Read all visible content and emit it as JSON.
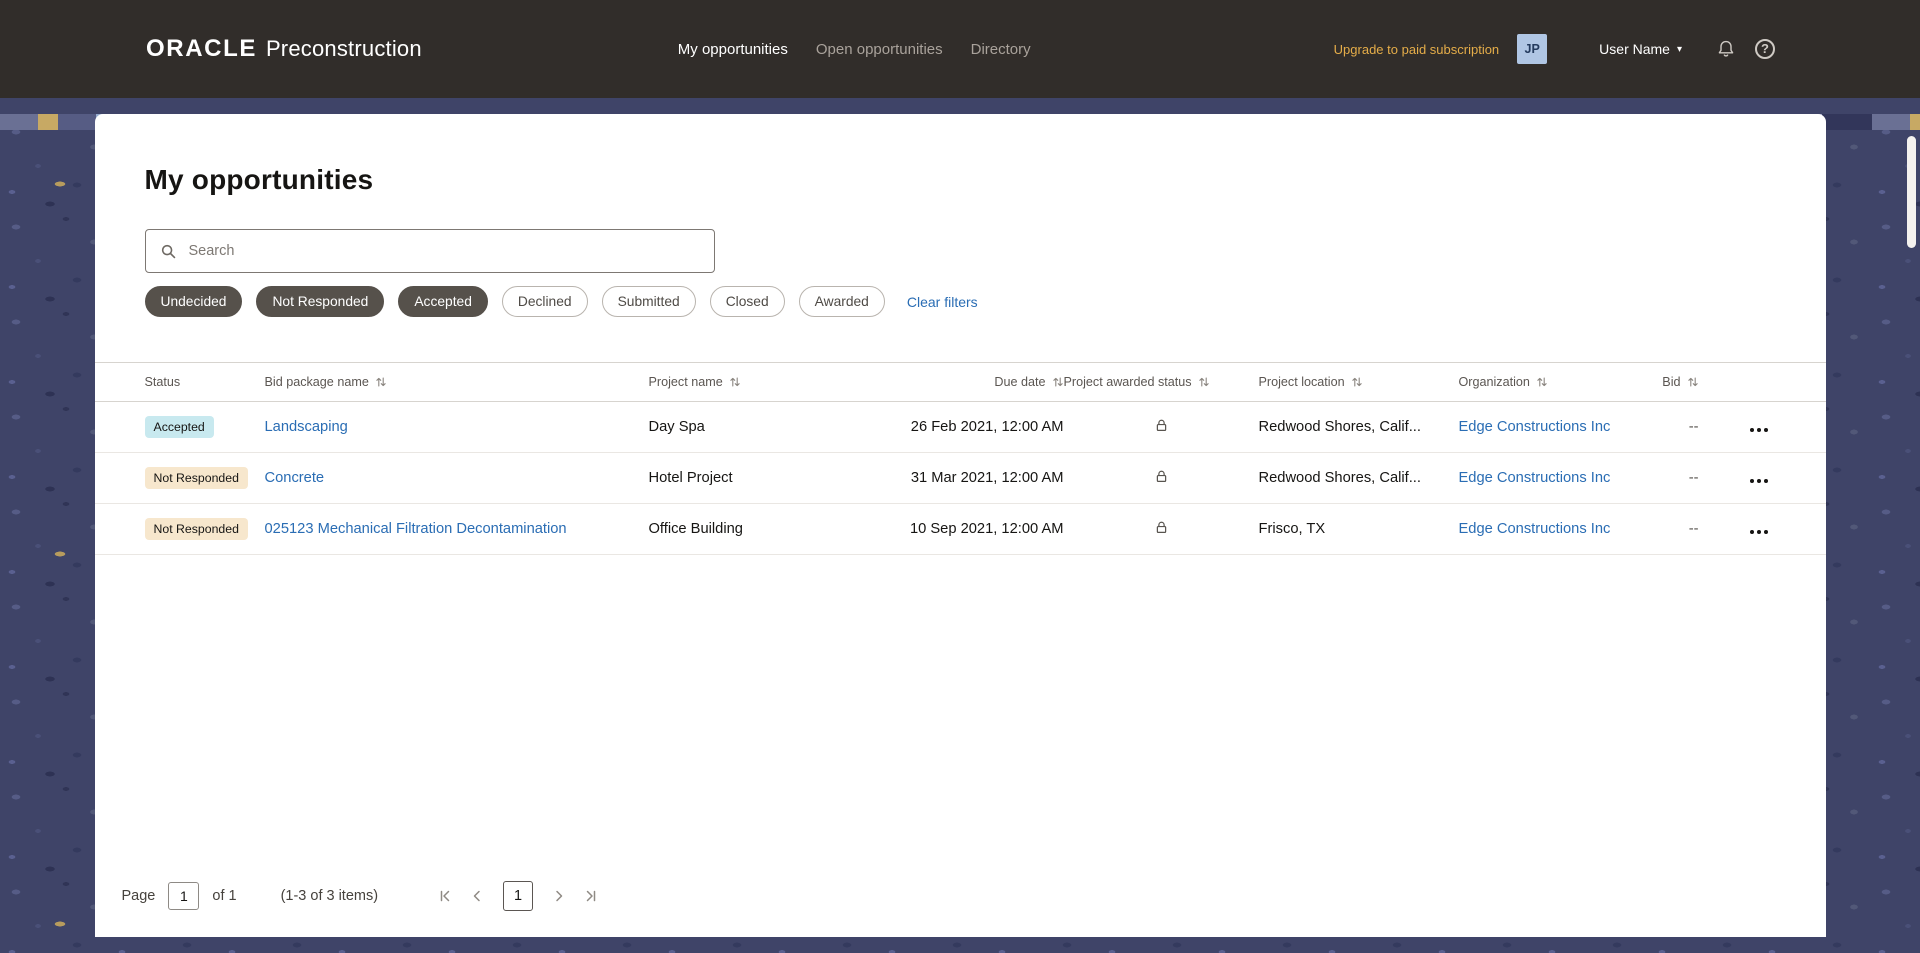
{
  "navbar": {
    "brand_oracle": "ORACLE",
    "brand_product": "Preconstruction",
    "nav_items": [
      {
        "label": "My opportunities",
        "active": true
      },
      {
        "label": "Open opportunities",
        "active": false
      },
      {
        "label": "Directory",
        "active": false
      }
    ],
    "upgrade_link": "Upgrade to paid subscription",
    "avatar_initials": "JP",
    "user_menu": "User Name"
  },
  "page": {
    "title": "My opportunities",
    "search_placeholder": "Search",
    "filters": {
      "chips": [
        {
          "label": "Undecided",
          "selected": true
        },
        {
          "label": "Not Responded",
          "selected": true
        },
        {
          "label": "Accepted",
          "selected": true
        },
        {
          "label": "Declined",
          "selected": false
        },
        {
          "label": "Submitted",
          "selected": false
        },
        {
          "label": "Closed",
          "selected": false
        },
        {
          "label": "Awarded",
          "selected": false
        }
      ],
      "clear_label": "Clear filters"
    }
  },
  "table": {
    "columns": [
      {
        "label": "Status",
        "sortable": false
      },
      {
        "label": "Bid package name",
        "sortable": true
      },
      {
        "label": "Project name",
        "sortable": true
      },
      {
        "label": "Due date",
        "sortable": true
      },
      {
        "label": "Project awarded status",
        "sortable": true
      },
      {
        "label": "Project location",
        "sortable": true
      },
      {
        "label": "Organization",
        "sortable": true
      },
      {
        "label": "Bid",
        "sortable": true
      }
    ],
    "rows": [
      {
        "status": "Accepted",
        "bid_package": "Landscaping",
        "project": "Day Spa",
        "due": "26 Feb 2021, 12:00 AM",
        "awarded": "locked",
        "location": "Redwood Shores, Calif...",
        "organization": "Edge Constructions Inc",
        "bid": "--"
      },
      {
        "status": "Not Responded",
        "bid_package": "Concrete",
        "project": "Hotel Project",
        "due": "31 Mar 2021, 12:00 AM",
        "awarded": "locked",
        "location": "Redwood Shores, Calif...",
        "organization": "Edge Constructions Inc",
        "bid": "--"
      },
      {
        "status": "Not Responded",
        "bid_package": "025123 Mechanical Filtration Decontamination",
        "project": "Office Building",
        "due": "10 Sep 2021, 12:00 AM",
        "awarded": "locked",
        "location": "Frisco, TX",
        "organization": "Edge Constructions Inc",
        "bid": "--"
      }
    ]
  },
  "pagination": {
    "page_label": "Page",
    "page_value": "1",
    "of_label": "of 1",
    "items_label": "(1-3 of 3 items)",
    "current_page": "1"
  },
  "icons": {
    "search": "magnifier",
    "notifications": "bell",
    "help": "question-mark-circle",
    "user_caret": "chevron-down",
    "sort": "up-down-arrows",
    "awarded_status": "padlock",
    "row_actions": "ellipsis",
    "pager": [
      "first-page",
      "previous-page",
      "next-page",
      "last-page"
    ]
  },
  "colors": {
    "navbar_bg": "#312d2a",
    "accent_gold": "#e5ad49",
    "link_blue": "#2a6db4",
    "chip_selected_bg": "#56514b",
    "badge_accepted_bg": "#c8e9ef",
    "badge_not_responded_bg": "#f7e7cd",
    "pattern_bg": "#3f4468",
    "avatar_bg": "#b0c6e4"
  }
}
